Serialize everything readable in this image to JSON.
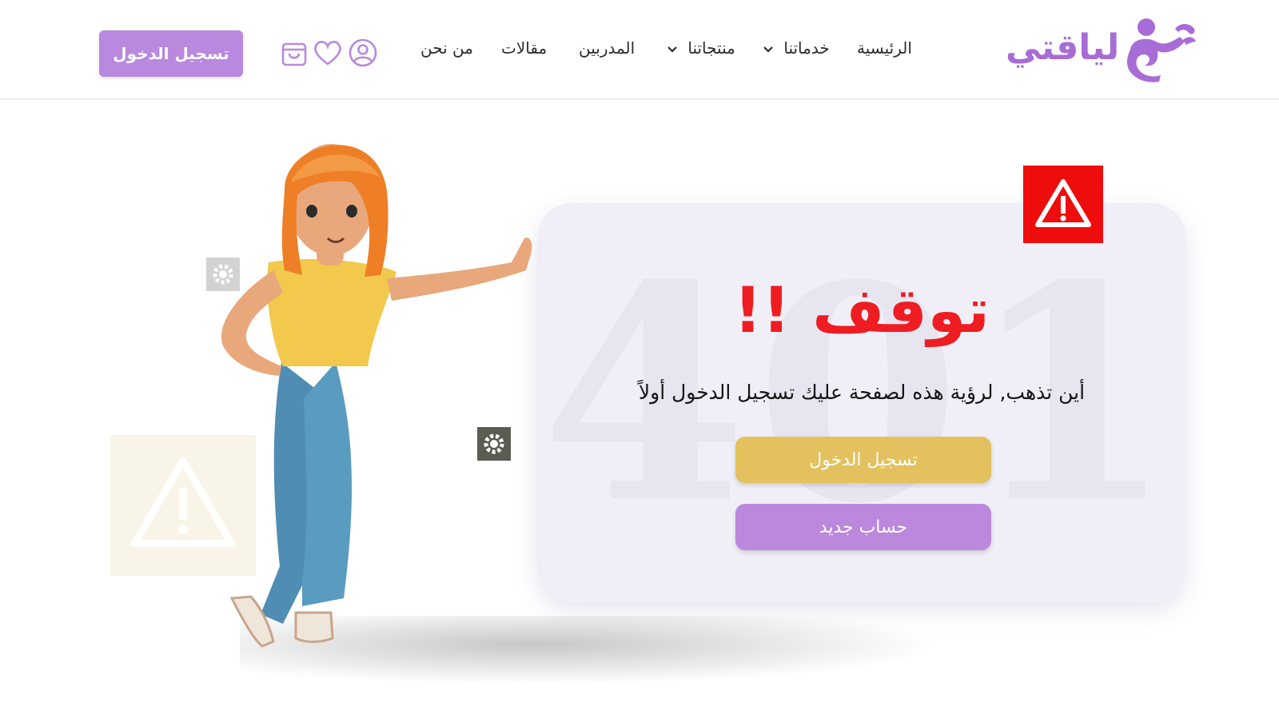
{
  "brand": {
    "logo_text": "لياقتي",
    "accent": "#a86cd6"
  },
  "nav": {
    "items": [
      {
        "label": "الرئيسية",
        "has_dropdown": false
      },
      {
        "label": "خدماتنا",
        "has_dropdown": true
      },
      {
        "label": "منتجاتنا",
        "has_dropdown": true
      },
      {
        "label": "المدربين",
        "has_dropdown": false
      },
      {
        "label": "مقالات",
        "has_dropdown": false
      },
      {
        "label": "من نحن",
        "has_dropdown": false
      }
    ],
    "icons": [
      "user-icon",
      "heart-icon",
      "shopping-bag-icon"
    ],
    "login_label": "تسجيل الدخول"
  },
  "error": {
    "bg_code": "401",
    "title": "توقف !!",
    "message": "أين تذهب, لرؤية هذه لصفحة عليك تسجيل الدخول أولاً",
    "login_button": "تسجيل الدخول",
    "register_button": "حساب جديد",
    "title_color": "#ee1d22",
    "login_color": "#e3c15e",
    "register_color": "#bb88dd"
  },
  "decor": {
    "icons": [
      "warning-icon",
      "gear-icon",
      "character-illustration"
    ]
  }
}
